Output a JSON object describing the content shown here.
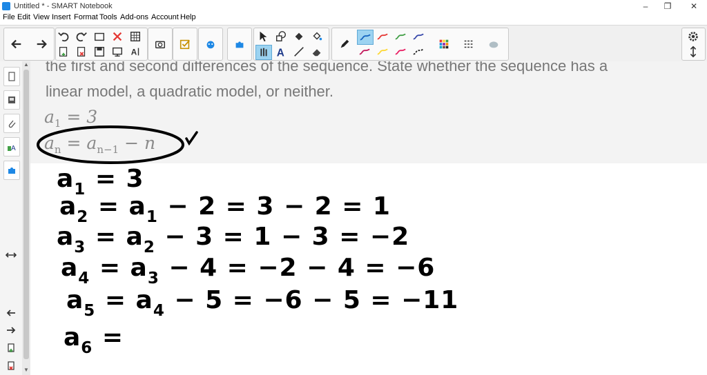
{
  "window": {
    "title": "Untitled * - SMART Notebook",
    "controls": [
      "–",
      "❐",
      "✕"
    ]
  },
  "menu": [
    "File",
    "Edit",
    "View",
    "Insert",
    "Format",
    "Tools",
    "Add-ons",
    "Account",
    "Help"
  ],
  "toolbar": {
    "active_pen_color": "#1565c0",
    "pen_colors": [
      "#1565c0",
      "#e53935",
      "#43a047",
      "#3949ab",
      "#c2185b",
      "#fdd835",
      "#e91e63",
      "#212121"
    ],
    "text_tool_glyph": "A"
  },
  "problem": {
    "line1": "the first and second differences of the sequence. State whether the sequence has a",
    "line2": "linear model, a quadratic model, or neither.",
    "given1": {
      "lhs": "a",
      "lhs_sub": "1",
      "rhs": "= 3"
    },
    "given2": {
      "lhs": "a",
      "lhs_sub": "n",
      "rhs_a": "= a",
      "rhs_sub": "n−1",
      "rhs_b": "− n"
    }
  },
  "handwriting": [
    {
      "pre": "a",
      "sub": "1",
      "post": " = 3"
    },
    {
      "pre": "a",
      "sub": "2",
      "mid": " = a",
      "sub2": "1",
      "post": " − 2 = 3 − 2 = 1"
    },
    {
      "pre": "a",
      "sub": "3",
      "mid": " = a",
      "sub2": "2",
      "post": " − 3 = 1 − 3 = −2"
    },
    {
      "pre": "a",
      "sub": "4",
      "mid": " = a",
      "sub2": "3",
      "post": " − 4 = −2 − 4 = −6"
    },
    {
      "pre": "a",
      "sub": "5",
      "mid": " = a",
      "sub2": "4",
      "post": " − 5 = −6 − 5 = −11"
    },
    {
      "pre": "a",
      "sub": "6",
      "post": " ="
    }
  ]
}
